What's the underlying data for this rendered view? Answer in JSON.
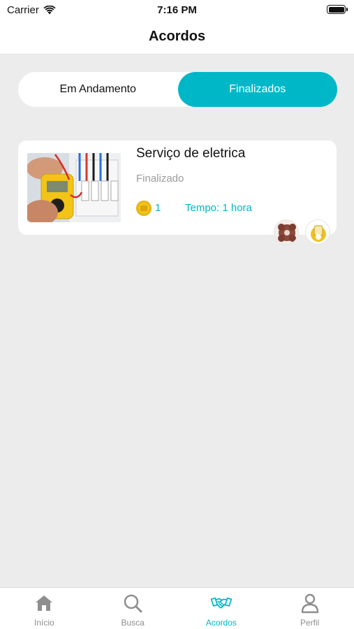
{
  "status_bar": {
    "carrier": "Carrier",
    "time": "7:16 PM"
  },
  "nav": {
    "title": "Acordos"
  },
  "segments": [
    {
      "label": "Em Andamento",
      "selected": false
    },
    {
      "label": "Finalizados",
      "selected": true
    }
  ],
  "agreements": [
    {
      "title": "Serviço de eletrica",
      "status": "Finalizado",
      "coins": "1",
      "duration": "Tempo: 1 hora"
    }
  ],
  "tab_bar": {
    "tabs": [
      {
        "label": "Início",
        "icon": "home-icon",
        "selected": false
      },
      {
        "label": "Busca",
        "icon": "search-icon",
        "selected": false
      },
      {
        "label": "Acordos",
        "icon": "handshake-icon",
        "selected": true
      },
      {
        "label": "Perfil",
        "icon": "person-icon",
        "selected": false
      }
    ]
  },
  "colors": {
    "accent": "#00b7c8",
    "background": "#ececec",
    "inactive_tab": "#8e8e8e"
  }
}
